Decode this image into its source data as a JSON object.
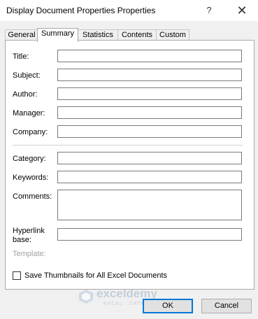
{
  "window": {
    "title": "Display Document Properties Properties",
    "help_label": "?",
    "close_label": "✕"
  },
  "tabs": [
    {
      "label": "General"
    },
    {
      "label": "Summary"
    },
    {
      "label": "Statistics"
    },
    {
      "label": "Contents"
    },
    {
      "label": "Custom"
    }
  ],
  "active_tab": "Summary",
  "fields": {
    "title": {
      "label": "Title:",
      "value": ""
    },
    "subject": {
      "label": "Subject:",
      "value": ""
    },
    "author": {
      "label": "Author:",
      "value": ""
    },
    "manager": {
      "label": "Manager:",
      "value": ""
    },
    "company": {
      "label": "Company:",
      "value": ""
    },
    "category": {
      "label": "Category:",
      "value": ""
    },
    "keywords": {
      "label": "Keywords:",
      "value": ""
    },
    "comments": {
      "label": "Comments:",
      "value": ""
    },
    "hyperlink_base": {
      "label_line1": "Hyperlink",
      "label_line2": "base:",
      "value": ""
    },
    "template": {
      "label": "Template:",
      "value": ""
    }
  },
  "save_thumbnails": {
    "label": "Save Thumbnails for All Excel Documents",
    "checked": false
  },
  "watermark": {
    "text": "exceldemy",
    "sub": "EXCEL · DATA · BI"
  },
  "buttons": {
    "ok": "OK",
    "cancel": "Cancel"
  }
}
